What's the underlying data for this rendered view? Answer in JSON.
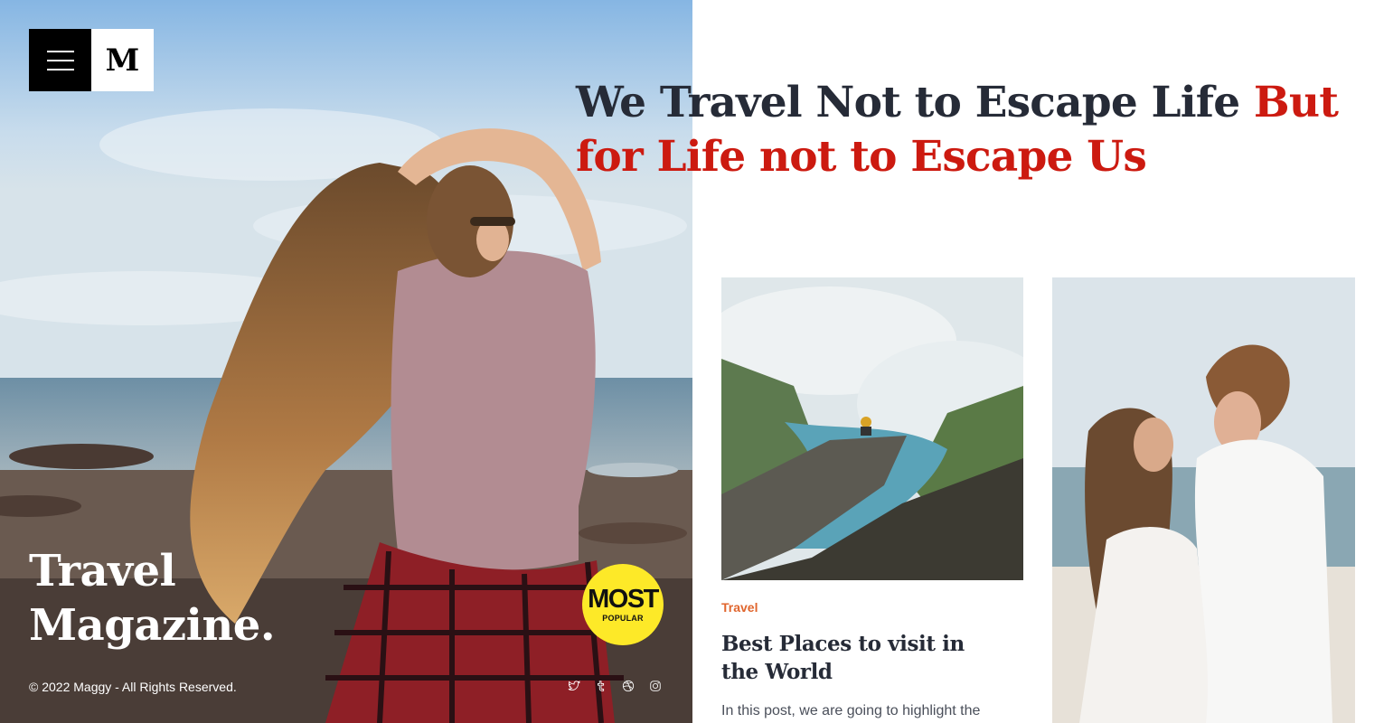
{
  "brand": {
    "logo_letter": "M",
    "menu_icon": "hamburger-icon"
  },
  "hero": {
    "title": "Travel Magazine.",
    "copyright": "© 2022 Maggy - All Rights Reserved.",
    "badge": {
      "top": "MOST",
      "bottom": "POPULAR",
      "color": "#fde928"
    },
    "socials": [
      {
        "icon": "twitter-icon"
      },
      {
        "icon": "tumblr-icon"
      },
      {
        "icon": "dribbble-icon"
      },
      {
        "icon": "instagram-icon"
      }
    ]
  },
  "headline": {
    "dark": "We Travel Not to Escape Life ",
    "accent": "But for Life not to Escape Us",
    "dark_color": "#262b37",
    "accent_color": "#cc1a10"
  },
  "posts": [
    {
      "category": "Travel",
      "title": "Best Places to visit in the World",
      "excerpt": "In this post, we are going to highlight the"
    }
  ],
  "colors": {
    "category": "#e0662e"
  }
}
